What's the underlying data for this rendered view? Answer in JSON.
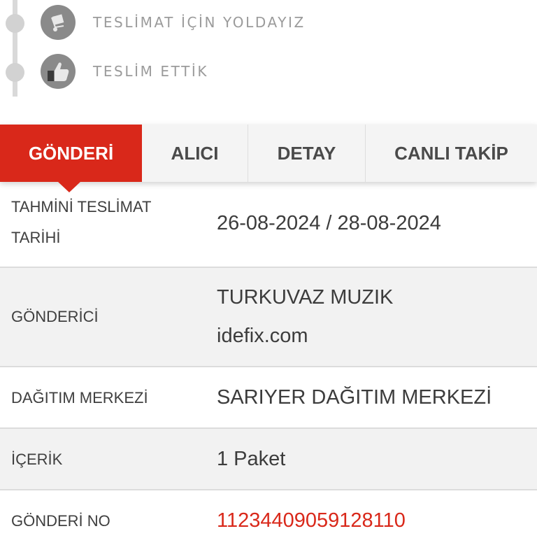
{
  "timeline": {
    "steps": [
      {
        "label": "TESLİMAT İÇİN YOLDAYIZ",
        "icon": "delivery-cart-icon"
      },
      {
        "label": "TESLİM ETTİK",
        "icon": "thumbs-up-icon"
      }
    ]
  },
  "tabs": [
    {
      "label": "GÖNDERİ",
      "active": true
    },
    {
      "label": "ALICI",
      "active": false
    },
    {
      "label": "DETAY",
      "active": false
    },
    {
      "label": "CANLI TAKİP",
      "active": false
    }
  ],
  "details": {
    "estimated_date": {
      "label_line1": "TAHMİNİ TESLİMAT",
      "label_line2": "TARİHİ",
      "value": "26-08-2024 / 28-08-2024"
    },
    "sender": {
      "label": "GÖNDERİCİ",
      "value_line1": "TURKUVAZ MUZIK",
      "value_line2": "idefix.com"
    },
    "distribution_center": {
      "label": "DAĞITIM MERKEZİ",
      "value": "SARIYER DAĞITIM MERKEZİ"
    },
    "content": {
      "label": "İÇERİK",
      "value": "1 Paket"
    },
    "shipment_no": {
      "label": "GÖNDERİ NO",
      "value": "1123440905912811​0"
    }
  },
  "colors": {
    "accent": "#d9281a",
    "tab_bg": "#f4f4f4",
    "row_alt_bg": "#f2f2f2"
  }
}
